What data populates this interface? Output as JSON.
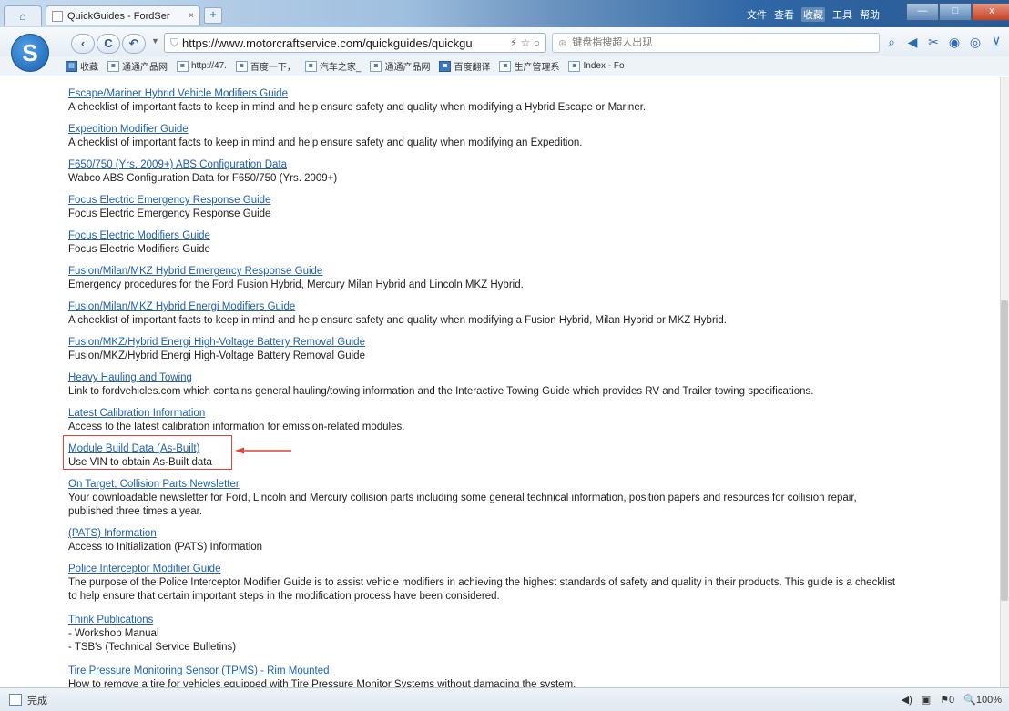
{
  "browser": {
    "home_icon": "home-icon",
    "tab": {
      "title": "QuickGuides - FordSer",
      "close": "×"
    },
    "new_tab": "+",
    "top_menu": [
      "文件",
      "查看",
      "收藏",
      "工具",
      "帮助"
    ],
    "window_buttons": [
      "—",
      "□",
      "x"
    ]
  },
  "toolbar": {
    "back": "‹",
    "refresh": "C",
    "undo": "↶",
    "url": "https://www.motorcraftservice.com/quickguides/quickgu",
    "url_icons": "⚡ ☆ ○",
    "search_placeholder": "键盘指搜超人出现"
  },
  "bookmarks": [
    {
      "label": "收藏",
      "icon": "folder"
    },
    {
      "label": "通通产品网",
      "icon": "page"
    },
    {
      "label": "http://47.",
      "icon": "page"
    },
    {
      "label": "百度一下，",
      "icon": "page"
    },
    {
      "label": "汽车之家_",
      "icon": "page"
    },
    {
      "label": "通通产品网",
      "icon": "page"
    },
    {
      "label": "百度翻译",
      "icon": "page"
    },
    {
      "label": "生产管理系",
      "icon": "page"
    },
    {
      "label": "Index - Fo",
      "icon": "page"
    }
  ],
  "guides": [
    {
      "title": "Escape/Mariner Hybrid Vehicle Modifiers Guide",
      "desc": [
        "A checklist of important facts to keep in mind and help ensure safety and quality when modifying a Hybrid Escape or Mariner."
      ]
    },
    {
      "title": "Expedition Modifier Guide",
      "desc": [
        "A checklist of important facts to keep in mind and help ensure safety and quality when modifying an Expedition."
      ]
    },
    {
      "title": "F650/750 (Yrs. 2009+) ABS Configuration Data",
      "desc": [
        "Wabco ABS Configuration Data for F650/750 (Yrs. 2009+)"
      ]
    },
    {
      "title": "Focus Electric Emergency Response Guide",
      "desc": [
        "Focus Electric Emergency Response Guide"
      ]
    },
    {
      "title": "Focus Electric Modifiers Guide",
      "desc": [
        "Focus Electric Modifiers Guide"
      ]
    },
    {
      "title": "Fusion/Milan/MKZ Hybrid Emergency Response Guide",
      "desc": [
        "Emergency procedures for the Ford Fusion Hybrid, Mercury Milan Hybrid and Lincoln MKZ Hybrid."
      ]
    },
    {
      "title": "Fusion/Milan/MKZ Hybrid Energi Modifiers Guide",
      "desc": [
        "A checklist of important facts to keep in mind and help ensure safety and quality when modifying a Fusion Hybrid, Milan Hybrid or MKZ Hybrid."
      ]
    },
    {
      "title": "Fusion/MKZ/Hybrid Energi High-Voltage Battery Removal Guide",
      "desc": [
        "Fusion/MKZ/Hybrid Energi High-Voltage Battery Removal Guide"
      ]
    },
    {
      "title": "Heavy Hauling and Towing",
      "desc": [
        "Link to fordvehicles.com which contains general hauling/towing information and the Interactive Towing Guide which provides RV and Trailer towing specifications."
      ]
    },
    {
      "title": "Latest Calibration Information",
      "desc": [
        "Access to the latest calibration information for emission-related modules."
      ]
    },
    {
      "title": "Module Build Data (As-Built)",
      "desc": [
        "Use VIN to obtain As-Built data"
      ]
    },
    {
      "title": "On Target, Collision Parts Newsletter",
      "desc": [
        "Your downloadable newsletter for Ford, Lincoln and Mercury collision parts including some general technical information, position papers and resources for collision repair,",
        "published three times a year."
      ]
    },
    {
      "title": "(PATS) Information",
      "desc": [
        "Access to Initialization (PATS) Information"
      ]
    },
    {
      "title": "Police Interceptor Modifier Guide",
      "desc": [
        "The purpose of the Police Interceptor Modifier Guide is to assist vehicle modifiers in achieving the highest standards of safety and quality in their products. This guide is a checklist",
        "to help ensure that certain important steps in the modification process have been considered."
      ]
    },
    {
      "title": "Think Publications",
      "desc": [
        "- Workshop Manual",
        "- TSB's (Technical Service Bulletins)"
      ]
    },
    {
      "title": "Tire Pressure Monitoring Sensor (TPMS) - Rim Mounted",
      "desc": [
        "How to remove a tire for vehicles equipped with Tire Pressure Monitor Systems without damaging the system."
      ]
    }
  ],
  "highlight_color": "#e0443a",
  "status": {
    "text": "完成",
    "right": [
      "◀)",
      "▣",
      "⚑0",
      "🔍100%"
    ]
  }
}
